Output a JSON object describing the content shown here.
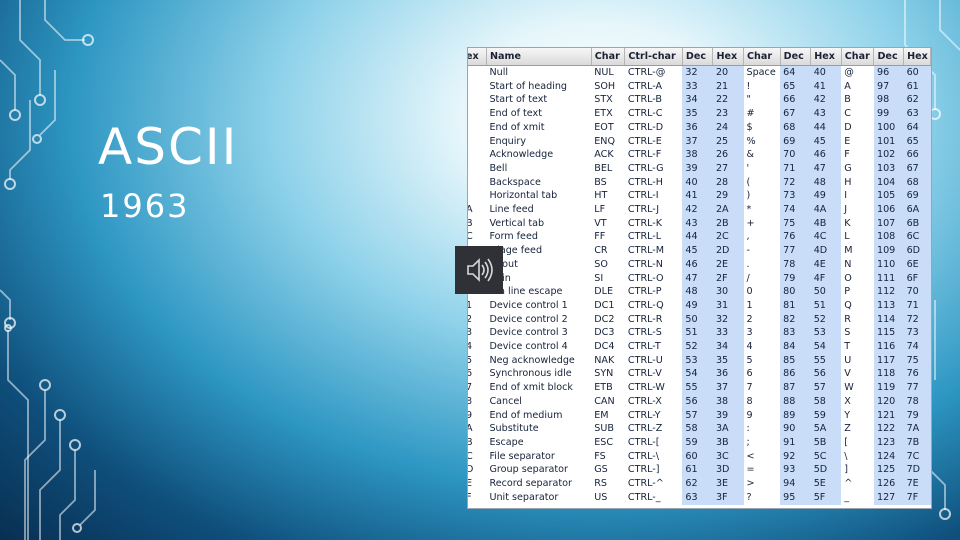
{
  "slide": {
    "title": "ASCII",
    "subtitle": "1963"
  },
  "audio": {
    "icon": "speaker-icon"
  },
  "ascii_table": {
    "headers": [
      "ex",
      "Name",
      "Char",
      "Ctrl-char",
      "Dec",
      "Hex",
      "Char",
      "Dec",
      "Hex",
      "Char",
      "Dec",
      "Hex"
    ],
    "rows": [
      [
        "",
        "Null",
        "NUL",
        "CTRL-@",
        "32",
        "20",
        "Space",
        "64",
        "40",
        "@",
        "96",
        "60"
      ],
      [
        "",
        "Start of heading",
        "SOH",
        "CTRL-A",
        "33",
        "21",
        "!",
        "65",
        "41",
        "A",
        "97",
        "61"
      ],
      [
        "",
        "Start of text",
        "STX",
        "CTRL-B",
        "34",
        "22",
        "\"",
        "66",
        "42",
        "B",
        "98",
        "62"
      ],
      [
        "",
        "End of text",
        "ETX",
        "CTRL-C",
        "35",
        "23",
        "#",
        "67",
        "43",
        "C",
        "99",
        "63"
      ],
      [
        "",
        "End of xmit",
        "EOT",
        "CTRL-D",
        "36",
        "24",
        "$",
        "68",
        "44",
        "D",
        "100",
        "64"
      ],
      [
        "",
        "Enquiry",
        "ENQ",
        "CTRL-E",
        "37",
        "25",
        "%",
        "69",
        "45",
        "E",
        "101",
        "65"
      ],
      [
        "",
        "Acknowledge",
        "ACK",
        "CTRL-F",
        "38",
        "26",
        "&",
        "70",
        "46",
        "F",
        "102",
        "66"
      ],
      [
        "",
        "Bell",
        "BEL",
        "CTRL-G",
        "39",
        "27",
        "'",
        "71",
        "47",
        "G",
        "103",
        "67"
      ],
      [
        "",
        "Backspace",
        "BS",
        "CTRL-H",
        "40",
        "28",
        "(",
        "72",
        "48",
        "H",
        "104",
        "68"
      ],
      [
        "",
        "Horizontal tab",
        "HT",
        "CTRL-I",
        "41",
        "29",
        ")",
        "73",
        "49",
        "I",
        "105",
        "69"
      ],
      [
        "A",
        "Line feed",
        "LF",
        "CTRL-J",
        "42",
        "2A",
        "*",
        "74",
        "4A",
        "J",
        "106",
        "6A"
      ],
      [
        "B",
        "Vertical tab",
        "VT",
        "CTRL-K",
        "43",
        "2B",
        "+",
        "75",
        "4B",
        "K",
        "107",
        "6B"
      ],
      [
        "C",
        "Form feed",
        "FF",
        "CTRL-L",
        "44",
        "2C",
        ",",
        "76",
        "4C",
        "L",
        "108",
        "6C"
      ],
      [
        "",
        "rriage feed",
        "CR",
        "CTRL-M",
        "45",
        "2D",
        "-",
        "77",
        "4D",
        "M",
        "109",
        "6D"
      ],
      [
        "",
        "ift out",
        "SO",
        "CTRL-N",
        "46",
        "2E",
        ".",
        "78",
        "4E",
        "N",
        "110",
        "6E"
      ],
      [
        "",
        "ift in",
        "SI",
        "CTRL-O",
        "47",
        "2F",
        "/",
        "79",
        "4F",
        "O",
        "111",
        "6F"
      ],
      [
        "",
        "ata line escape",
        "DLE",
        "CTRL-P",
        "48",
        "30",
        "0",
        "80",
        "50",
        "P",
        "112",
        "70"
      ],
      [
        "1",
        "Device control 1",
        "DC1",
        "CTRL-Q",
        "49",
        "31",
        "1",
        "81",
        "51",
        "Q",
        "113",
        "71"
      ],
      [
        "2",
        "Device control 2",
        "DC2",
        "CTRL-R",
        "50",
        "32",
        "2",
        "82",
        "52",
        "R",
        "114",
        "72"
      ],
      [
        "3",
        "Device control 3",
        "DC3",
        "CTRL-S",
        "51",
        "33",
        "3",
        "83",
        "53",
        "S",
        "115",
        "73"
      ],
      [
        "4",
        "Device control 4",
        "DC4",
        "CTRL-T",
        "52",
        "34",
        "4",
        "84",
        "54",
        "T",
        "116",
        "74"
      ],
      [
        "5",
        "Neg acknowledge",
        "NAK",
        "CTRL-U",
        "53",
        "35",
        "5",
        "85",
        "55",
        "U",
        "117",
        "75"
      ],
      [
        "6",
        "Synchronous idle",
        "SYN",
        "CTRL-V",
        "54",
        "36",
        "6",
        "86",
        "56",
        "V",
        "118",
        "76"
      ],
      [
        "7",
        "End of xmit block",
        "ETB",
        "CTRL-W",
        "55",
        "37",
        "7",
        "87",
        "57",
        "W",
        "119",
        "77"
      ],
      [
        "8",
        "Cancel",
        "CAN",
        "CTRL-X",
        "56",
        "38",
        "8",
        "88",
        "58",
        "X",
        "120",
        "78"
      ],
      [
        "9",
        "End of medium",
        "EM",
        "CTRL-Y",
        "57",
        "39",
        "9",
        "89",
        "59",
        "Y",
        "121",
        "79"
      ],
      [
        "A",
        "Substitute",
        "SUB",
        "CTRL-Z",
        "58",
        "3A",
        ":",
        "90",
        "5A",
        "Z",
        "122",
        "7A"
      ],
      [
        "B",
        "Escape",
        "ESC",
        "CTRL-[",
        "59",
        "3B",
        ";",
        "91",
        "5B",
        "[",
        "123",
        "7B"
      ],
      [
        "C",
        "File separator",
        "FS",
        "CTRL-\\",
        "60",
        "3C",
        "<",
        "92",
        "5C",
        "\\",
        "124",
        "7C"
      ],
      [
        "D",
        "Group separator",
        "GS",
        "CTRL-]",
        "61",
        "3D",
        "=",
        "93",
        "5D",
        "]",
        "125",
        "7D"
      ],
      [
        "E",
        "Record separator",
        "RS",
        "CTRL-^",
        "62",
        "3E",
        ">",
        "94",
        "5E",
        "^",
        "126",
        "7E"
      ],
      [
        "F",
        "Unit separator",
        "US",
        "CTRL-_",
        "63",
        "3F",
        "?",
        "95",
        "5F",
        "_",
        "127",
        "7F"
      ]
    ]
  }
}
